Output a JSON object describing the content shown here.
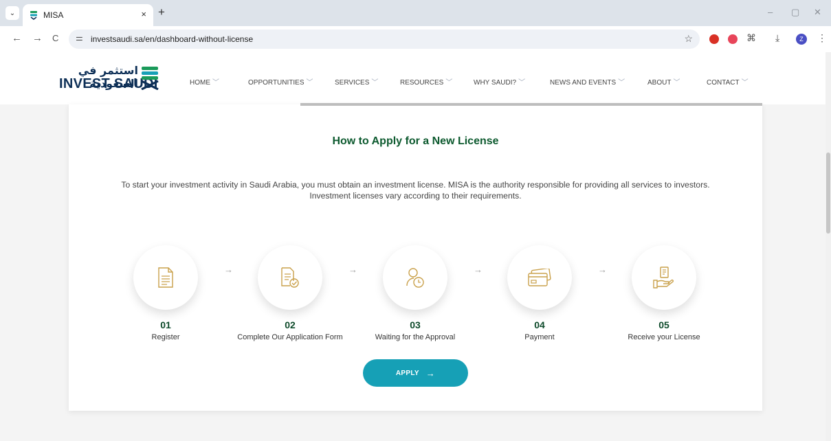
{
  "browser": {
    "tab": {
      "title": "MISA",
      "close_glyph": "×"
    },
    "new_tab_glyph": "+",
    "tab_menu_glyph": "⌄",
    "nav": {
      "back": "←",
      "forward": "→",
      "reload": "C"
    },
    "url": "investsaudi.sa/en/dashboard-without-license",
    "site_info_glyph": "⚌",
    "star_glyph": "☆",
    "download_glyph": "⤓",
    "extensions_glyph": "⌘",
    "menu_glyph": "⋮",
    "profile_initial": "Z",
    "window": {
      "minimize": "–",
      "restore": "▢",
      "close": "✕"
    }
  },
  "header": {
    "logo_arabic": "استثمر في السعودية",
    "logo_english": "INVEST SAUDI",
    "nav_items": [
      {
        "label": "HOME"
      },
      {
        "label": "OPPORTUNITIES"
      },
      {
        "label": "SERVICES"
      },
      {
        "label": "RESOURCES"
      },
      {
        "label": "WHY SAUDI?"
      },
      {
        "label": "NEWS AND EVENTS"
      },
      {
        "label": "ABOUT"
      },
      {
        "label": "CONTACT"
      }
    ],
    "chevron_glyph": "﹀"
  },
  "main": {
    "title": "How to Apply for a New License",
    "intro_line1": "To start your investment activity in Saudi Arabia, you must obtain an investment license. MISA is the authority responsible for providing all services to investors.",
    "intro_line2": "Investment licenses vary according to their requirements.",
    "arrow_glyph": "→",
    "steps": [
      {
        "number": "01",
        "label": "Register",
        "icon": "document-icon"
      },
      {
        "number": "02",
        "label": "Complete Our Application Form",
        "icon": "form-check-icon"
      },
      {
        "number": "03",
        "label": "Waiting for the Approval",
        "icon": "user-clock-icon"
      },
      {
        "number": "04",
        "label": "Payment",
        "icon": "payment-cards-icon"
      },
      {
        "number": "05",
        "label": "Receive your License",
        "icon": "license-hand-icon"
      }
    ],
    "apply_label": "APPLY",
    "apply_arrow": "→"
  },
  "colors": {
    "brand_green": "#0d5a2f",
    "accent_teal": "#16a0b6",
    "icon_gold": "#c9a04a",
    "logo_navy": "#0d2f56"
  }
}
